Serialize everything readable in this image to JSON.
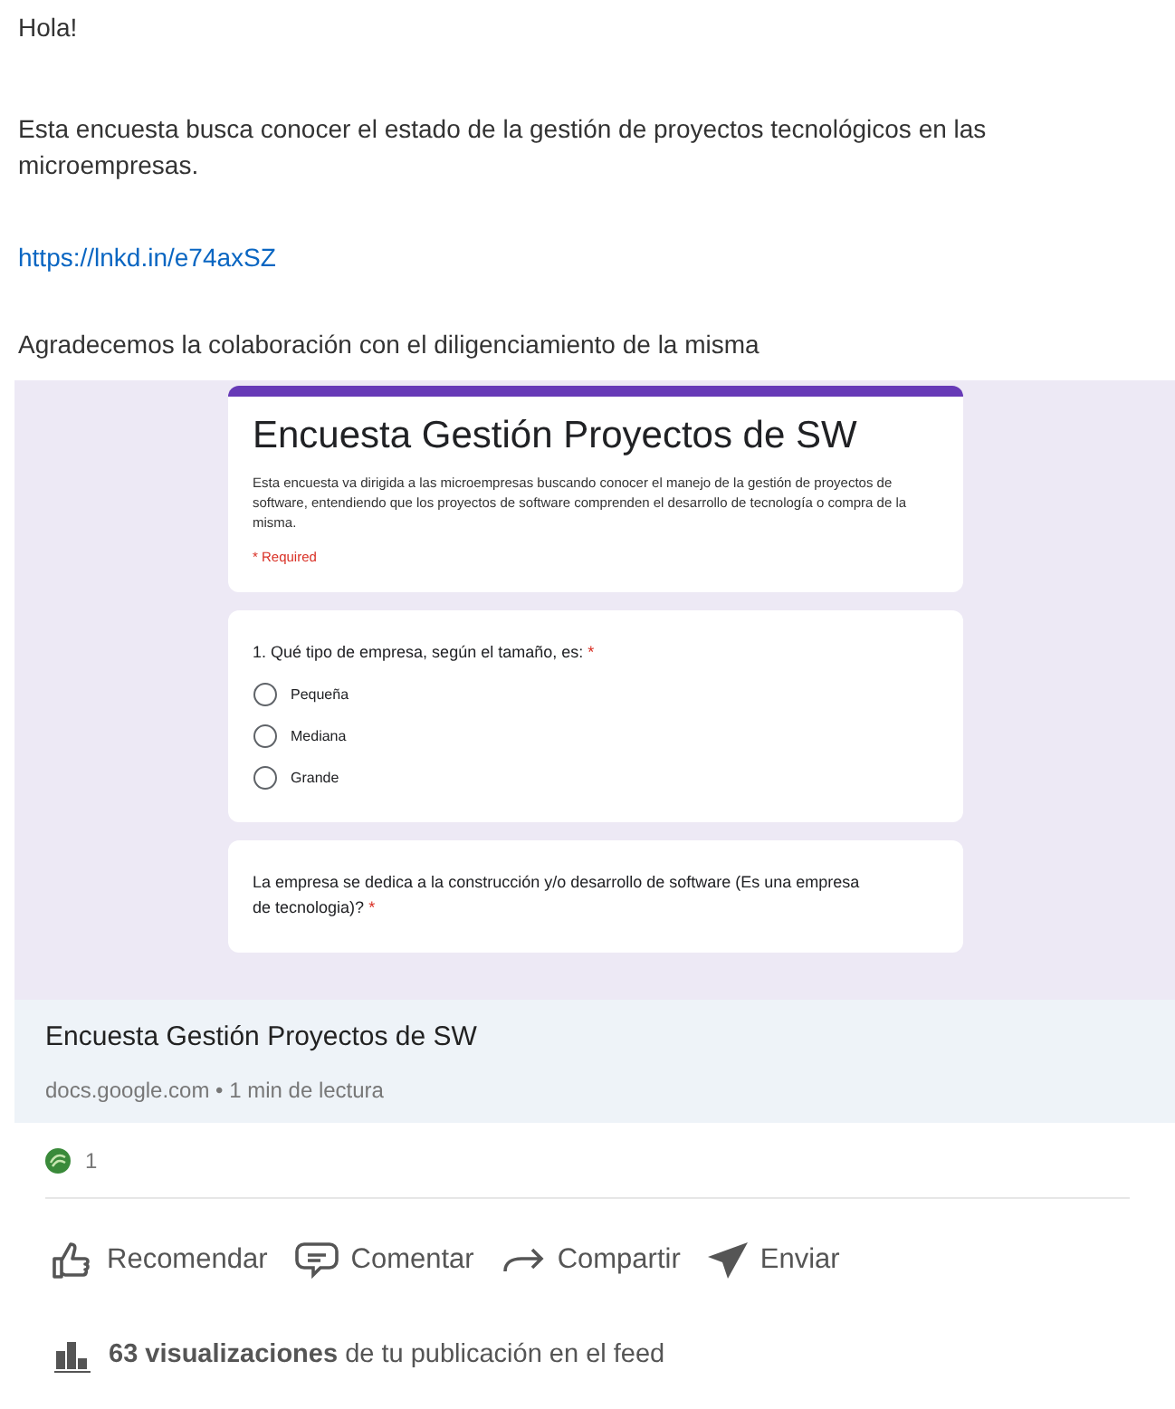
{
  "post": {
    "greeting": "Hola!",
    "body": "Esta encuesta busca conocer el estado de la gestión de proyectos tecnológicos en las microempresas.",
    "link": "https://lnkd.in/e74axSZ",
    "closing": "Agradecemos la colaboración con el diligenciamiento de la misma"
  },
  "form_preview": {
    "title": "Encuesta Gestión Proyectos de SW",
    "description": "Esta encuesta va dirigida a las microempresas buscando conocer el manejo de la gestión de proyectos de software, entendiendo que los proyectos de software comprenden el desarrollo de tecnología o compra de la misma.",
    "required_note": "* Required",
    "questions": [
      {
        "text": "1. Qué tipo de empresa, según el tamaño, es:",
        "required_mark": "*",
        "options": [
          {
            "label": "Pequeña",
            "selected": false
          },
          {
            "label": "Mediana",
            "selected": false
          },
          {
            "label": "Grande",
            "selected": false
          }
        ]
      },
      {
        "text": "La empresa se dedica a la construcción y/o desarrollo de software (Es una empresa de tecnologia)?",
        "required_mark": "*"
      }
    ]
  },
  "link_card": {
    "title": "Encuesta Gestión Proyectos de SW",
    "meta": "docs.google.com • 1 min de lectura"
  },
  "reactions": {
    "count": "1"
  },
  "actions": [
    {
      "kind": "like",
      "label": "Recomendar"
    },
    {
      "kind": "comment",
      "label": "Comentar"
    },
    {
      "kind": "share",
      "label": "Compartir"
    },
    {
      "kind": "send",
      "label": "Enviar"
    }
  ],
  "views": {
    "text": "**63 visualizaciones** de tu publicación en el feed"
  }
}
